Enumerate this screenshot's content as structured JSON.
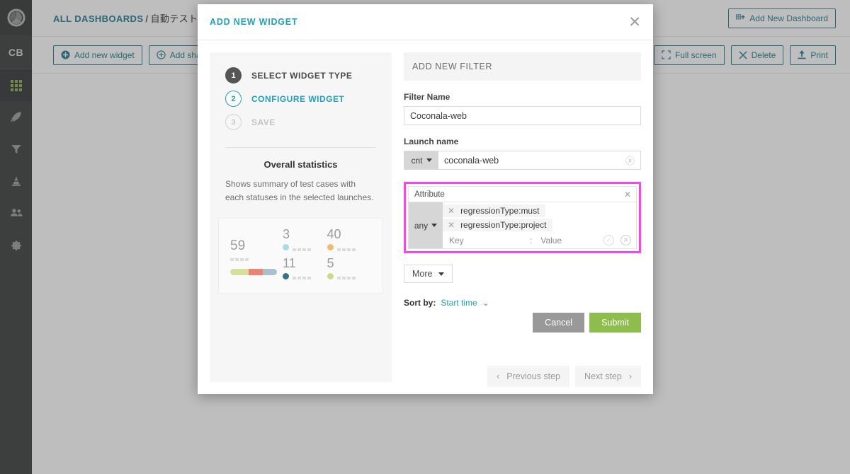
{
  "sidebar": {
    "logo_icon": "aperture-logo-icon",
    "project_badge": "CB",
    "items": [
      {
        "name": "dashboards",
        "icon": "grid-dots-icon",
        "active": true
      },
      {
        "name": "launches",
        "icon": "rocket-icon",
        "active": false
      },
      {
        "name": "filters",
        "icon": "funnel-icon",
        "active": false
      },
      {
        "name": "debug",
        "icon": "traffic-cone-icon",
        "active": false
      },
      {
        "name": "members",
        "icon": "users-icon",
        "active": false
      },
      {
        "name": "settings",
        "icon": "gear-icon",
        "active": false
      }
    ]
  },
  "topbar": {
    "breadcrumb_root": "ALL DASHBOARDS",
    "breadcrumb_sep": "/",
    "breadcrumb_current": "自動テストモニ",
    "add_dashboard_label": "Add New Dashboard",
    "add_dashboard_icon": "grid-plus-icon"
  },
  "toolbar": {
    "add_widget_label": "Add new widget",
    "add_widget_icon": "plus-circle-filled-icon",
    "add_shared_label": "Add shar",
    "add_shared_icon": "plus-circle-outline-icon",
    "fullscreen_label": "Full screen",
    "fullscreen_icon": "expand-icon",
    "delete_label": "Delete",
    "delete_icon": "close-x-icon",
    "print_label": "Print",
    "print_icon": "upload-arrow-icon"
  },
  "modal": {
    "title": "ADD NEW WIDGET",
    "close_icon": "close-icon",
    "steps": [
      {
        "num": "1",
        "label": "SELECT WIDGET TYPE",
        "state": "done"
      },
      {
        "num": "2",
        "label": "CONFIGURE WIDGET",
        "state": "cur"
      },
      {
        "num": "3",
        "label": "SAVE",
        "state": "todo"
      }
    ],
    "widget_title": "Overall statistics",
    "widget_desc": "Shows summary of test cases with each statuses in the selected launches.",
    "prev_step_label": "Previous step",
    "prev_step_icon": "chevron-left-icon",
    "next_step_label": "Next step",
    "next_step_icon": "chevron-right-icon"
  },
  "preview": {
    "total_value": "59",
    "bar_segments": [
      {
        "color": "#d8de9c",
        "pct": 40
      },
      {
        "color": "#ec8376",
        "pct": 30
      },
      {
        "color": "#a8c2cc",
        "pct": 30
      }
    ],
    "cells": [
      {
        "value": "3",
        "dot_color": "#a6dbe8"
      },
      {
        "value": "40",
        "dot_color": "#f0bb6e"
      },
      {
        "value": "11",
        "dot_color": "#3a7183"
      },
      {
        "value": "5",
        "dot_color": "#cdd98a"
      }
    ]
  },
  "filter": {
    "section_title": "ADD NEW FILTER",
    "name_label": "Filter Name",
    "name_value": "Coconala-web",
    "name_placeholder": "Filter Name",
    "launch_label": "Launch name",
    "launch_condition": "cnt",
    "launch_value": "coconala-web",
    "launch_clear_icon": "clear-circle-icon",
    "attribute_label": "Attribute",
    "attribute_close_icon": "close-small-icon",
    "attribute_condition": "any",
    "attribute_tags": [
      {
        "remove_icon": "remove-x-icon",
        "text": "regressionType:must"
      },
      {
        "remove_icon": "remove-x-icon",
        "text": "regressionType:project"
      }
    ],
    "kv_key_placeholder": "Key",
    "kv_colon": ":",
    "kv_value_placeholder": "Value",
    "kv_confirm_icon": "check-circle-icon",
    "kv_cancel_icon": "cancel-circle-icon",
    "more_label": "More",
    "sort_label": "Sort by:",
    "sort_value": "Start time",
    "sort_caret_icon": "chevron-down-icon",
    "cancel_label": "Cancel",
    "submit_label": "Submit"
  },
  "colors": {
    "accent_teal": "#20a0bd",
    "highlight_pink": "#fb44ec",
    "submit_green": "#8ebc4d",
    "cancel_gray": "#999999",
    "sidebar_dark": "#3a3c3d"
  }
}
